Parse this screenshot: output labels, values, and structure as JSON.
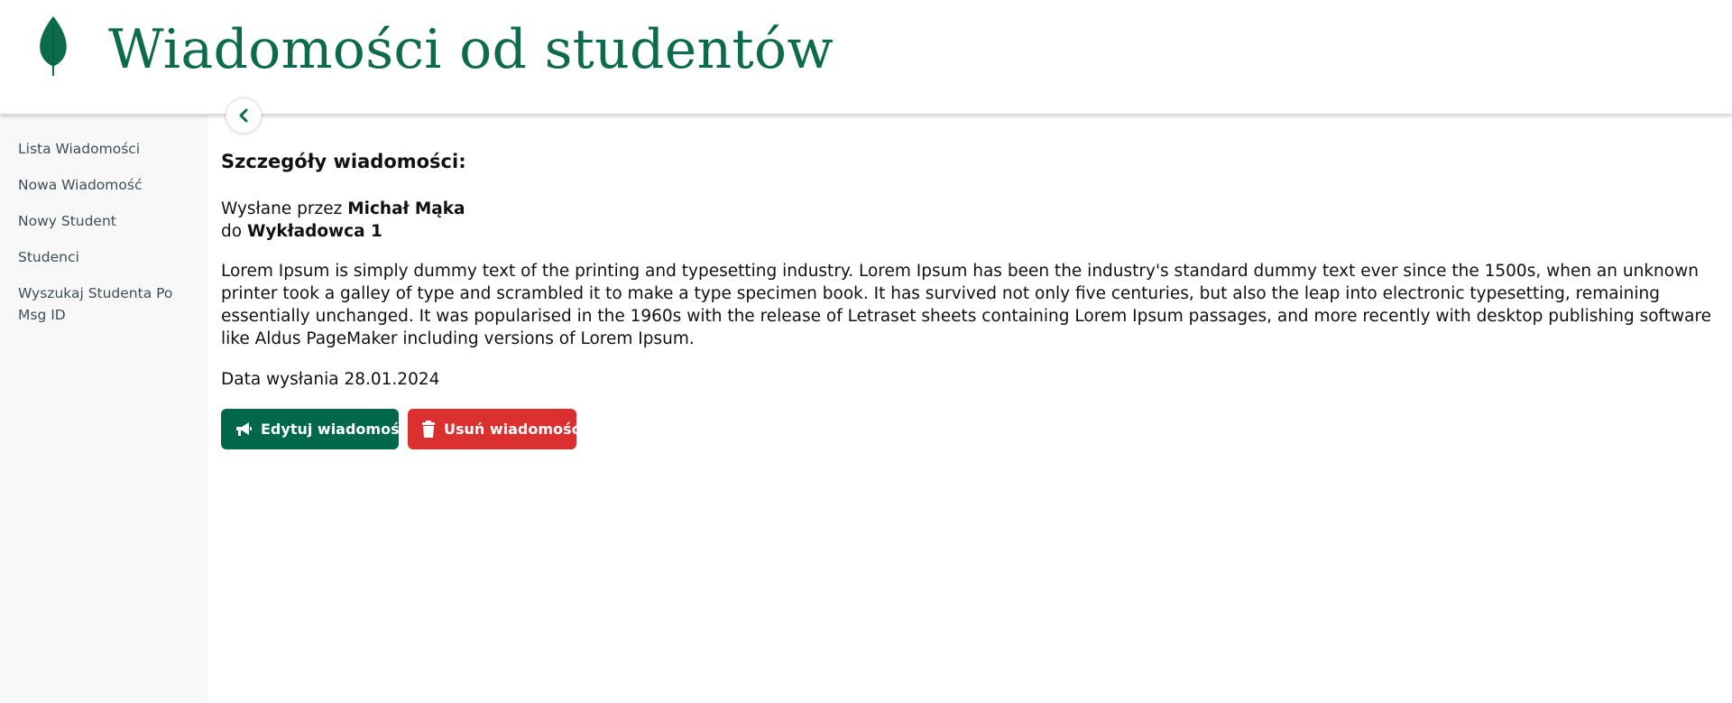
{
  "header": {
    "title": "Wiadomości od studentów",
    "logo_icon": "leaf-icon",
    "brand_color": "#0b6b4a"
  },
  "sidebar": {
    "items": [
      {
        "label": "Lista Wiadomości"
      },
      {
        "label": "Nowa Wiadomość"
      },
      {
        "label": "Nowy Student"
      },
      {
        "label": "Studenci"
      },
      {
        "label": "Wyszukaj Studenta Po Msg ID"
      }
    ],
    "collapse_icon": "chevron-left-icon"
  },
  "message": {
    "section_title": "Szczegóły wiadomości:",
    "sent_by_prefix": "Wysłane przez",
    "sender": "Michał Mąka",
    "to_prefix": "do",
    "recipient": "Wykładowca 1",
    "body": "Lorem Ipsum is simply dummy text of the printing and typesetting industry. Lorem Ipsum has been the industry's standard dummy text ever since the 1500s, when an unknown printer took a galley of type and scrambled it to make a type specimen book. It has survived not only five centuries, but also the leap into electronic typesetting, remaining essentially unchanged. It was popularised in the 1960s with the release of Letraset sheets containing Lorem Ipsum passages, and more recently with desktop publishing software like Aldus PageMaker including versions of Lorem Ipsum.",
    "date_label": "Data wysłania",
    "date_value": "28.01.2024"
  },
  "actions": {
    "edit_label": "Edytuj wiadomość",
    "edit_icon": "megaphone-icon",
    "edit_color": "#00684a",
    "delete_label": "Usuń wiadomość",
    "delete_icon": "trash-icon",
    "delete_color": "#db3030"
  }
}
